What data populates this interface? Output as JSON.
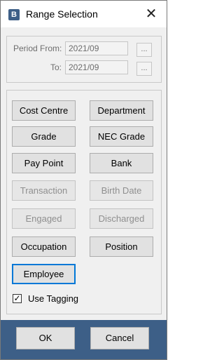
{
  "window": {
    "title": "Range Selection"
  },
  "period": {
    "from_label": "Period From:",
    "to_label": "To:",
    "from_value": "2021/09",
    "to_value": "2021/09",
    "browse_label": "..."
  },
  "buttons": [
    {
      "label": "Cost Centre",
      "enabled": true
    },
    {
      "label": "Department",
      "enabled": true
    },
    {
      "label": "Grade",
      "enabled": true
    },
    {
      "label": "NEC Grade",
      "enabled": true
    },
    {
      "label": "Pay Point",
      "enabled": true
    },
    {
      "label": "Bank",
      "enabled": true
    },
    {
      "label": "Transaction",
      "enabled": false
    },
    {
      "label": "Birth Date",
      "enabled": false
    },
    {
      "label": "Engaged",
      "enabled": false
    },
    {
      "label": "Discharged",
      "enabled": false
    },
    {
      "label": "Occupation",
      "enabled": true
    },
    {
      "label": "Position",
      "enabled": true
    },
    {
      "label": "Employee",
      "enabled": true,
      "focused": true
    }
  ],
  "use_tagging": {
    "label": "Use Tagging",
    "checked": true
  },
  "footer": {
    "ok_label": "OK",
    "cancel_label": "Cancel"
  },
  "colors": {
    "footer_bg": "#3d5f87",
    "focus": "#0078d7",
    "disabled_text": "#8f8f8f"
  }
}
